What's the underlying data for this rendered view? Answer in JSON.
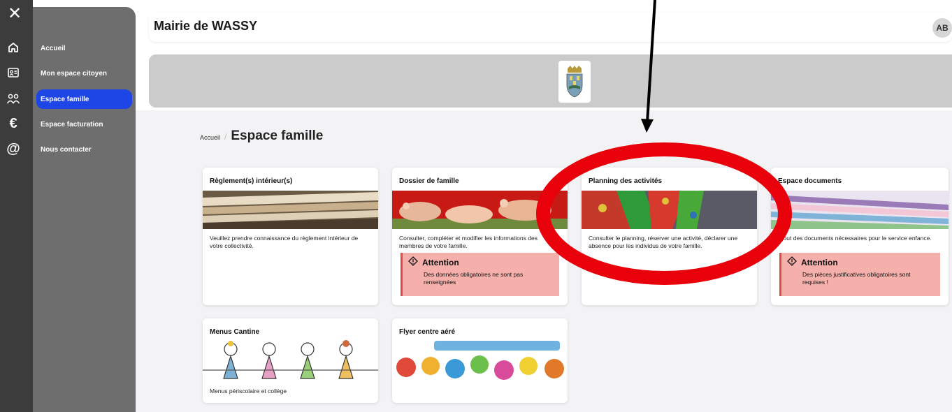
{
  "sidebar": {
    "close_glyph": "✕",
    "items": [
      {
        "label": "Accueil",
        "icon": "home-icon"
      },
      {
        "label": "Mon espace citoyen",
        "icon": "id-card-icon"
      },
      {
        "label": "Espace famille",
        "icon": "people-icon",
        "active": true
      },
      {
        "label": "Espace facturation",
        "icon": "euro-icon"
      },
      {
        "label": "Nous contacter",
        "icon": "at-icon"
      }
    ]
  },
  "header": {
    "title": "Mairie de WASSY",
    "avatar_initials": "AB"
  },
  "breadcrumb": {
    "home": "Accueil",
    "separator": "/",
    "current": "Espace famille"
  },
  "cards": [
    {
      "title": "Règlement(s) intérieur(s)",
      "image": "books-image",
      "description": "Veuillez prendre connaissance du règlement intérieur de votre collectivité."
    },
    {
      "title": "Dossier de famille",
      "image": "family-feet-image",
      "description": "Consulter, compléter et modifier les informations des membres de votre famille.",
      "alert": {
        "title": "Attention",
        "text": "Des données obligatoires ne sont pas renseignées"
      }
    },
    {
      "title": "Planning des activités",
      "image": "painted-hands-image",
      "description": "Consulter le planning, réserver une activité, déclarer une absence pour les individus de votre famille."
    },
    {
      "title": "Espace documents",
      "image": "documents-image",
      "description": "Ajout des documents nécessaires pour le service enfance.",
      "alert": {
        "title": "Attention",
        "text": "Des pièces justificatives obligatoires sont requises !"
      }
    },
    {
      "title": "Menus Cantine",
      "image": "children-drawing-image",
      "description": "Menus périscolaire et collège"
    },
    {
      "title": "Flyer centre aéré",
      "image": "colorful-hands-image",
      "description": ""
    }
  ],
  "colors": {
    "accent": "#1e46e6",
    "alert_bg": "#f5b0ac",
    "alert_border": "#e04a42",
    "annotation": "#e8000b"
  }
}
